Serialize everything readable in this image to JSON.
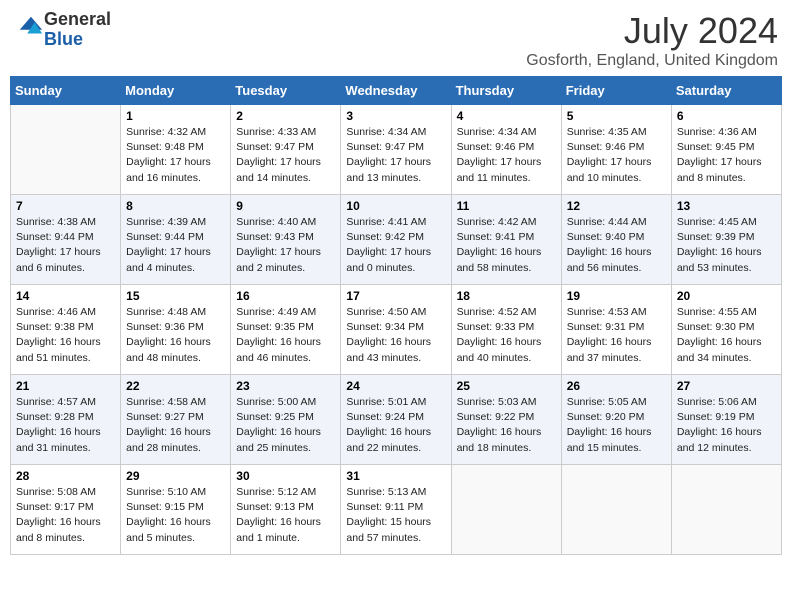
{
  "header": {
    "logo_general": "General",
    "logo_blue": "Blue",
    "month_title": "July 2024",
    "location": "Gosforth, England, United Kingdom"
  },
  "weekdays": [
    "Sunday",
    "Monday",
    "Tuesday",
    "Wednesday",
    "Thursday",
    "Friday",
    "Saturday"
  ],
  "weeks": [
    [
      {
        "day": "",
        "lines": []
      },
      {
        "day": "1",
        "lines": [
          "Sunrise: 4:32 AM",
          "Sunset: 9:48 PM",
          "Daylight: 17 hours",
          "and 16 minutes."
        ]
      },
      {
        "day": "2",
        "lines": [
          "Sunrise: 4:33 AM",
          "Sunset: 9:47 PM",
          "Daylight: 17 hours",
          "and 14 minutes."
        ]
      },
      {
        "day": "3",
        "lines": [
          "Sunrise: 4:34 AM",
          "Sunset: 9:47 PM",
          "Daylight: 17 hours",
          "and 13 minutes."
        ]
      },
      {
        "day": "4",
        "lines": [
          "Sunrise: 4:34 AM",
          "Sunset: 9:46 PM",
          "Daylight: 17 hours",
          "and 11 minutes."
        ]
      },
      {
        "day": "5",
        "lines": [
          "Sunrise: 4:35 AM",
          "Sunset: 9:46 PM",
          "Daylight: 17 hours",
          "and 10 minutes."
        ]
      },
      {
        "day": "6",
        "lines": [
          "Sunrise: 4:36 AM",
          "Sunset: 9:45 PM",
          "Daylight: 17 hours",
          "and 8 minutes."
        ]
      }
    ],
    [
      {
        "day": "7",
        "lines": [
          "Sunrise: 4:38 AM",
          "Sunset: 9:44 PM",
          "Daylight: 17 hours",
          "and 6 minutes."
        ]
      },
      {
        "day": "8",
        "lines": [
          "Sunrise: 4:39 AM",
          "Sunset: 9:44 PM",
          "Daylight: 17 hours",
          "and 4 minutes."
        ]
      },
      {
        "day": "9",
        "lines": [
          "Sunrise: 4:40 AM",
          "Sunset: 9:43 PM",
          "Daylight: 17 hours",
          "and 2 minutes."
        ]
      },
      {
        "day": "10",
        "lines": [
          "Sunrise: 4:41 AM",
          "Sunset: 9:42 PM",
          "Daylight: 17 hours",
          "and 0 minutes."
        ]
      },
      {
        "day": "11",
        "lines": [
          "Sunrise: 4:42 AM",
          "Sunset: 9:41 PM",
          "Daylight: 16 hours",
          "and 58 minutes."
        ]
      },
      {
        "day": "12",
        "lines": [
          "Sunrise: 4:44 AM",
          "Sunset: 9:40 PM",
          "Daylight: 16 hours",
          "and 56 minutes."
        ]
      },
      {
        "day": "13",
        "lines": [
          "Sunrise: 4:45 AM",
          "Sunset: 9:39 PM",
          "Daylight: 16 hours",
          "and 53 minutes."
        ]
      }
    ],
    [
      {
        "day": "14",
        "lines": [
          "Sunrise: 4:46 AM",
          "Sunset: 9:38 PM",
          "Daylight: 16 hours",
          "and 51 minutes."
        ]
      },
      {
        "day": "15",
        "lines": [
          "Sunrise: 4:48 AM",
          "Sunset: 9:36 PM",
          "Daylight: 16 hours",
          "and 48 minutes."
        ]
      },
      {
        "day": "16",
        "lines": [
          "Sunrise: 4:49 AM",
          "Sunset: 9:35 PM",
          "Daylight: 16 hours",
          "and 46 minutes."
        ]
      },
      {
        "day": "17",
        "lines": [
          "Sunrise: 4:50 AM",
          "Sunset: 9:34 PM",
          "Daylight: 16 hours",
          "and 43 minutes."
        ]
      },
      {
        "day": "18",
        "lines": [
          "Sunrise: 4:52 AM",
          "Sunset: 9:33 PM",
          "Daylight: 16 hours",
          "and 40 minutes."
        ]
      },
      {
        "day": "19",
        "lines": [
          "Sunrise: 4:53 AM",
          "Sunset: 9:31 PM",
          "Daylight: 16 hours",
          "and 37 minutes."
        ]
      },
      {
        "day": "20",
        "lines": [
          "Sunrise: 4:55 AM",
          "Sunset: 9:30 PM",
          "Daylight: 16 hours",
          "and 34 minutes."
        ]
      }
    ],
    [
      {
        "day": "21",
        "lines": [
          "Sunrise: 4:57 AM",
          "Sunset: 9:28 PM",
          "Daylight: 16 hours",
          "and 31 minutes."
        ]
      },
      {
        "day": "22",
        "lines": [
          "Sunrise: 4:58 AM",
          "Sunset: 9:27 PM",
          "Daylight: 16 hours",
          "and 28 minutes."
        ]
      },
      {
        "day": "23",
        "lines": [
          "Sunrise: 5:00 AM",
          "Sunset: 9:25 PM",
          "Daylight: 16 hours",
          "and 25 minutes."
        ]
      },
      {
        "day": "24",
        "lines": [
          "Sunrise: 5:01 AM",
          "Sunset: 9:24 PM",
          "Daylight: 16 hours",
          "and 22 minutes."
        ]
      },
      {
        "day": "25",
        "lines": [
          "Sunrise: 5:03 AM",
          "Sunset: 9:22 PM",
          "Daylight: 16 hours",
          "and 18 minutes."
        ]
      },
      {
        "day": "26",
        "lines": [
          "Sunrise: 5:05 AM",
          "Sunset: 9:20 PM",
          "Daylight: 16 hours",
          "and 15 minutes."
        ]
      },
      {
        "day": "27",
        "lines": [
          "Sunrise: 5:06 AM",
          "Sunset: 9:19 PM",
          "Daylight: 16 hours",
          "and 12 minutes."
        ]
      }
    ],
    [
      {
        "day": "28",
        "lines": [
          "Sunrise: 5:08 AM",
          "Sunset: 9:17 PM",
          "Daylight: 16 hours",
          "and 8 minutes."
        ]
      },
      {
        "day": "29",
        "lines": [
          "Sunrise: 5:10 AM",
          "Sunset: 9:15 PM",
          "Daylight: 16 hours",
          "and 5 minutes."
        ]
      },
      {
        "day": "30",
        "lines": [
          "Sunrise: 5:12 AM",
          "Sunset: 9:13 PM",
          "Daylight: 16 hours",
          "and 1 minute."
        ]
      },
      {
        "day": "31",
        "lines": [
          "Sunrise: 5:13 AM",
          "Sunset: 9:11 PM",
          "Daylight: 15 hours",
          "and 57 minutes."
        ]
      },
      {
        "day": "",
        "lines": []
      },
      {
        "day": "",
        "lines": []
      },
      {
        "day": "",
        "lines": []
      }
    ]
  ]
}
